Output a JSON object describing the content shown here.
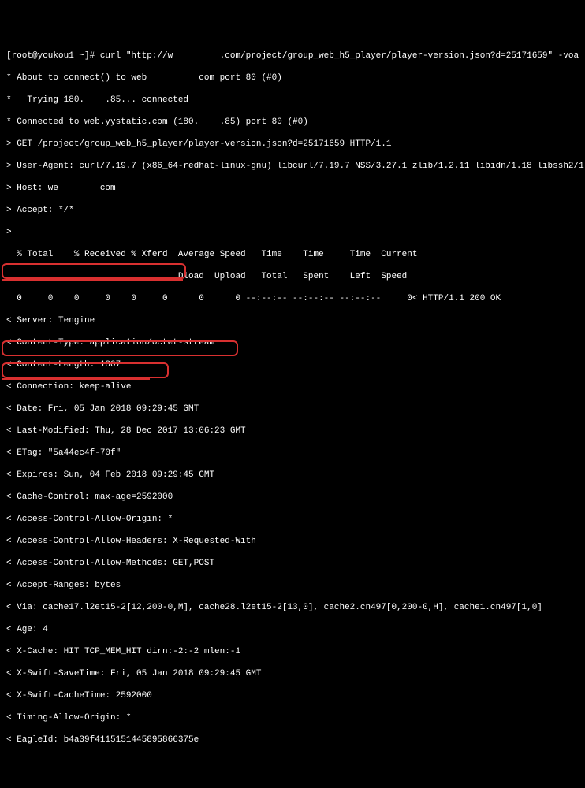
{
  "lines": {
    "l0": "[root@youkou1 ~]# curl \"http://w         .com/project/group_web_h5_player/player-version.json?d=25171659\" -voa",
    "l1": "* About to connect() to web          com port 80 (#0)",
    "l2": "*   Trying 180.    .85... connected",
    "l3": "* Connected to web.yystatic.com (180.    .85) port 80 (#0)",
    "l4": "> GET /project/group_web_h5_player/player-version.json?d=25171659 HTTP/1.1",
    "l5": "> User-Agent: curl/7.19.7 (x86_64-redhat-linux-gnu) libcurl/7.19.7 NSS/3.27.1 zlib/1.2.11 libidn/1.18 libssh2/1.4.2",
    "l6": "> Host: we        com",
    "l7": "> Accept: */*",
    "l8": ">",
    "l9": "  % Total    % Received % Xferd  Average Speed   Time    Time     Time  Current",
    "l10": "                                 Dload  Upload   Total   Spent    Left  Speed",
    "l11": "  0     0    0     0    0     0      0      0 --:--:-- --:--:-- --:--:--     0< HTTP/1.1 200 OK",
    "l12": "< Server: Tengine",
    "l13": "< Content-Type: application/octet-stream",
    "l14": "< Content-Length: 1807",
    "l15": "< Connection: keep-alive",
    "l16": "< Date: Fri, 05 Jan 2018 09:29:45 GMT",
    "l17": "< Last-Modified: Thu, 28 Dec 2017 13:06:23 GMT",
    "l18": "< ETag: \"5a44ec4f-70f\"",
    "l19": "< Expires: Sun, 04 Feb 2018 09:29:45 GMT",
    "l20": "< Cache-Control: max-age=2592000",
    "l21": "< Access-Control-Allow-Origin: *",
    "l22": "< Access-Control-Allow-Headers: X-Requested-With",
    "l23": "< Access-Control-Allow-Methods: GET,POST",
    "l24": "< Accept-Ranges: bytes",
    "l25": "< Via: cache17.l2et15-2[12,200-0,M], cache28.l2et15-2[13,0], cache2.cn497[0,200-0,H], cache1.cn497[1,0]",
    "l26": "< Age: 4",
    "l27": "< X-Cache: HIT TCP_MEM_HIT dirn:-2:-2 mlen:-1",
    "l28": "< X-Swift-SaveTime: Fri, 05 Jan 2018 09:29:45 GMT",
    "l29": "< X-Swift-CacheTime: 2592000",
    "l30": "< Timing-Allow-Origin: *",
    "l31": "< EagleId: b4a39f4115151445895866375e"
  }
}
